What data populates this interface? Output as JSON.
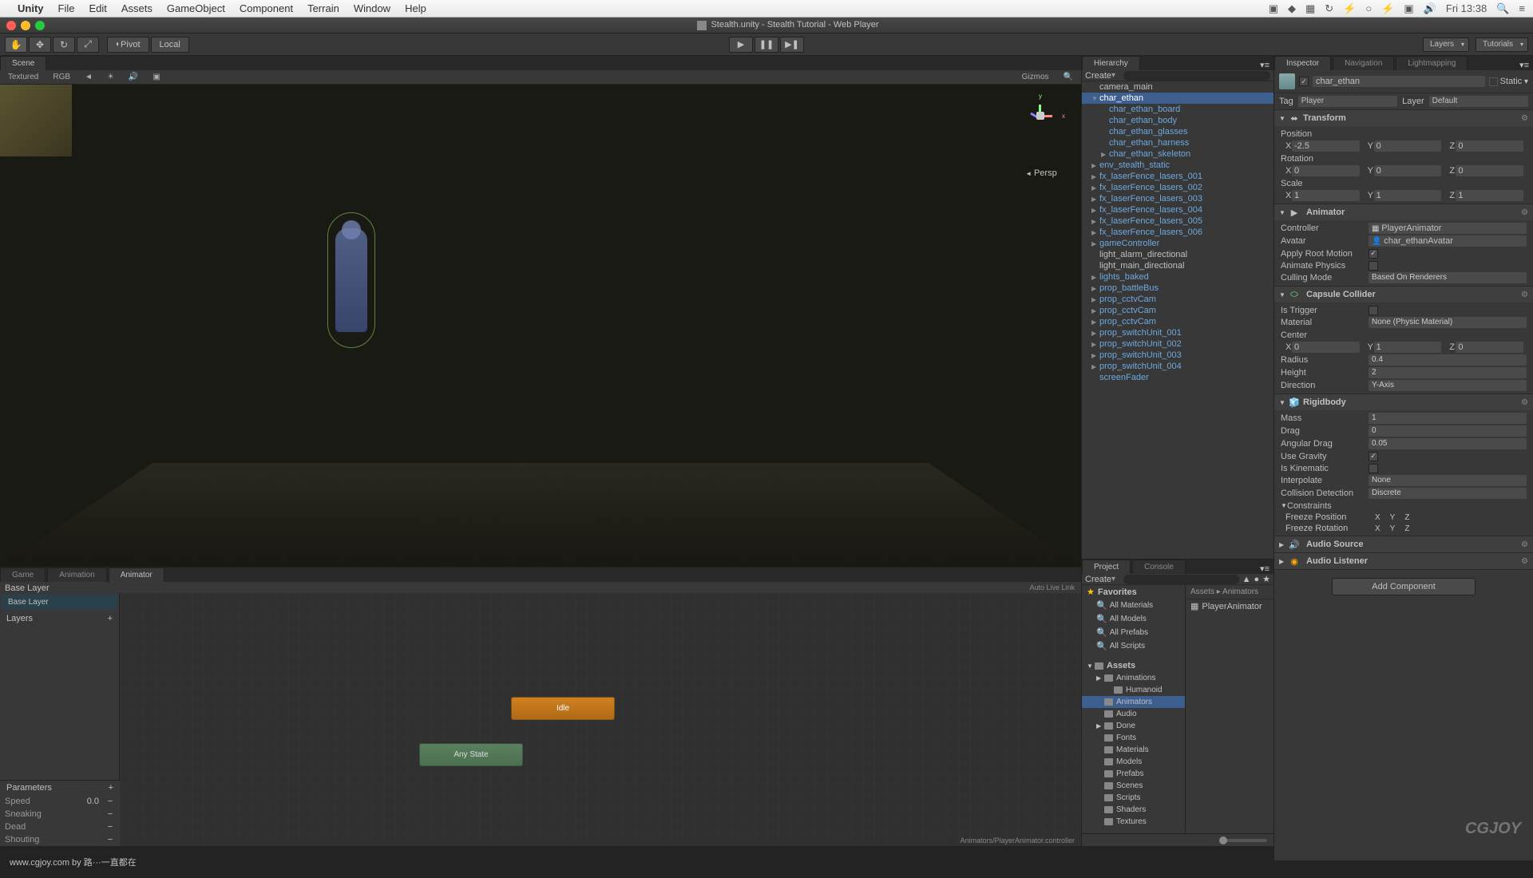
{
  "mac_menu": {
    "app": "Unity",
    "items": [
      "File",
      "Edit",
      "Assets",
      "GameObject",
      "Component",
      "Terrain",
      "Window",
      "Help"
    ],
    "time": "Fri 13:38"
  },
  "window_title": "Stealth.unity - Stealth Tutorial - Web Player",
  "toolbar": {
    "pivot": "Pivot",
    "local": "Local",
    "layers": "Layers",
    "layout": "Tutorials"
  },
  "scene": {
    "tab": "Scene",
    "shading": "Textured",
    "mode": "RGB",
    "gizmos": "Gizmos",
    "persp": "Persp"
  },
  "animator": {
    "tabs": [
      "Game",
      "Animation",
      "Animator"
    ],
    "active_tab": "Animator",
    "header": "Base Layer",
    "base_layer": "Base Layer",
    "layers": "Layers",
    "auto_live": "Auto Live Link",
    "states": {
      "idle": "Idle",
      "any": "Any State"
    },
    "params_header": "Parameters",
    "params": [
      {
        "name": "Speed",
        "val": "0.0"
      },
      {
        "name": "Sneaking",
        "val": ""
      },
      {
        "name": "Dead",
        "val": ""
      },
      {
        "name": "Shouting",
        "val": ""
      }
    ],
    "path": "Animators/PlayerAnimator.controller"
  },
  "hierarchy": {
    "tab": "Hierarchy",
    "create": "Create",
    "items": [
      {
        "name": "camera_main",
        "blue": false,
        "child": false,
        "arrow": ""
      },
      {
        "name": "char_ethan",
        "blue": false,
        "child": false,
        "selected": true,
        "arrow": "▼"
      },
      {
        "name": "char_ethan_board",
        "blue": true,
        "child": true,
        "arrow": ""
      },
      {
        "name": "char_ethan_body",
        "blue": true,
        "child": true,
        "arrow": ""
      },
      {
        "name": "char_ethan_glasses",
        "blue": true,
        "child": true,
        "arrow": ""
      },
      {
        "name": "char_ethan_harness",
        "blue": true,
        "child": true,
        "arrow": ""
      },
      {
        "name": "char_ethan_skeleton",
        "blue": true,
        "child": true,
        "arrow": "▶"
      },
      {
        "name": "env_stealth_static",
        "blue": true,
        "child": false,
        "arrow": "▶"
      },
      {
        "name": "fx_laserFence_lasers_001",
        "blue": true,
        "child": false,
        "arrow": "▶"
      },
      {
        "name": "fx_laserFence_lasers_002",
        "blue": true,
        "child": false,
        "arrow": "▶"
      },
      {
        "name": "fx_laserFence_lasers_003",
        "blue": true,
        "child": false,
        "arrow": "▶"
      },
      {
        "name": "fx_laserFence_lasers_004",
        "blue": true,
        "child": false,
        "arrow": "▶"
      },
      {
        "name": "fx_laserFence_lasers_005",
        "blue": true,
        "child": false,
        "arrow": "▶"
      },
      {
        "name": "fx_laserFence_lasers_006",
        "blue": true,
        "child": false,
        "arrow": "▶"
      },
      {
        "name": "gameController",
        "blue": true,
        "child": false,
        "arrow": "▶"
      },
      {
        "name": "light_alarm_directional",
        "blue": false,
        "child": false,
        "arrow": ""
      },
      {
        "name": "light_main_directional",
        "blue": false,
        "child": false,
        "arrow": ""
      },
      {
        "name": "lights_baked",
        "blue": true,
        "child": false,
        "arrow": "▶"
      },
      {
        "name": "prop_battleBus",
        "blue": true,
        "child": false,
        "arrow": "▶"
      },
      {
        "name": "prop_cctvCam",
        "blue": true,
        "child": false,
        "arrow": "▶"
      },
      {
        "name": "prop_cctvCam",
        "blue": true,
        "child": false,
        "arrow": "▶"
      },
      {
        "name": "prop_cctvCam",
        "blue": true,
        "child": false,
        "arrow": "▶"
      },
      {
        "name": "prop_switchUnit_001",
        "blue": true,
        "child": false,
        "arrow": "▶"
      },
      {
        "name": "prop_switchUnit_002",
        "blue": true,
        "child": false,
        "arrow": "▶"
      },
      {
        "name": "prop_switchUnit_003",
        "blue": true,
        "child": false,
        "arrow": "▶"
      },
      {
        "name": "prop_switchUnit_004",
        "blue": true,
        "child": false,
        "arrow": "▶"
      },
      {
        "name": "screenFader",
        "blue": true,
        "child": false,
        "arrow": ""
      }
    ]
  },
  "project": {
    "tab": "Project",
    "console_tab": "Console",
    "create": "Create",
    "breadcrumb": "Assets ▸ Animators",
    "favorites": "Favorites",
    "fav_items": [
      "All Materials",
      "All Models",
      "All Prefabs",
      "All Scripts"
    ],
    "assets": "Assets",
    "folders": [
      "Animations",
      "Humanoid",
      "Animators",
      "Audio",
      "Done",
      "Fonts",
      "Materials",
      "Models",
      "Prefabs",
      "Scenes",
      "Scripts",
      "Shaders",
      "Textures"
    ],
    "selected_folder": "Animators",
    "content_item": "PlayerAnimator"
  },
  "inspector": {
    "tabs": [
      "Inspector",
      "Navigation",
      "Lightmapping"
    ],
    "name": "char_ethan",
    "static": "Static",
    "tag_label": "Tag",
    "tag": "Player",
    "layer_label": "Layer",
    "layer": "Default",
    "transform": {
      "title": "Transform",
      "position": "Position",
      "pos": {
        "x": "-2.5",
        "y": "0",
        "z": "0"
      },
      "rotation": "Rotation",
      "rot": {
        "x": "0",
        "y": "0",
        "z": "0"
      },
      "scale": "Scale",
      "scl": {
        "x": "1",
        "y": "1",
        "z": "1"
      }
    },
    "animator_comp": {
      "title": "Animator",
      "controller_label": "Controller",
      "controller": "PlayerAnimator",
      "avatar_label": "Avatar",
      "avatar": "char_ethanAvatar",
      "apply_root": "Apply Root Motion",
      "animate_physics": "Animate Physics",
      "culling_mode": "Culling Mode",
      "culling_val": "Based On Renderers"
    },
    "capsule": {
      "title": "Capsule Collider",
      "is_trigger": "Is Trigger",
      "material_label": "Material",
      "material": "None (Physic Material)",
      "center": "Center",
      "cen": {
        "x": "0",
        "y": "1",
        "z": "0"
      },
      "radius_label": "Radius",
      "radius": "0.4",
      "height_label": "Height",
      "height": "2",
      "direction_label": "Direction",
      "direction": "Y-Axis"
    },
    "rigidbody": {
      "title": "Rigidbody",
      "mass_label": "Mass",
      "mass": "1",
      "drag_label": "Drag",
      "drag": "0",
      "ang_drag_label": "Angular Drag",
      "ang_drag": "0.05",
      "use_gravity": "Use Gravity",
      "is_kinematic": "Is Kinematic",
      "interpolate_label": "Interpolate",
      "interpolate": "None",
      "collision_label": "Collision Detection",
      "collision": "Discrete",
      "constraints": "Constraints",
      "freeze_pos": "Freeze Position",
      "freeze_rot": "Freeze Rotation"
    },
    "audio_source": "Audio Source",
    "audio_listener": "Audio Listener",
    "add_component": "Add Component"
  },
  "bottom": "www.cgjoy.com by 路···一直都在",
  "watermark": "CGJOY"
}
